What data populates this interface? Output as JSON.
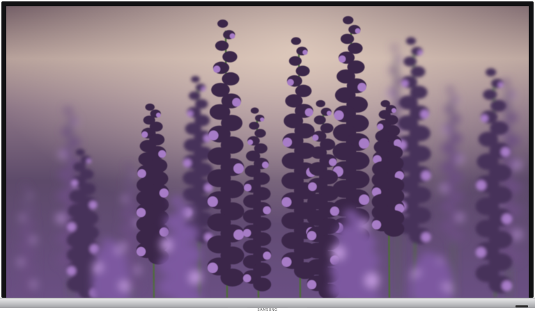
{
  "image": {
    "subject": "lavender-flowers-on-tv-screen"
  },
  "tv": {
    "brand_label": "SAMSUNG",
    "colors": {
      "bezel": "#111113",
      "stand_bar": "#c4c5c8",
      "flower": "#3b2548",
      "bloom": "#a77bc7",
      "sky_top": "#6c5662",
      "sky_bottom": "#7a5f8c"
    }
  }
}
